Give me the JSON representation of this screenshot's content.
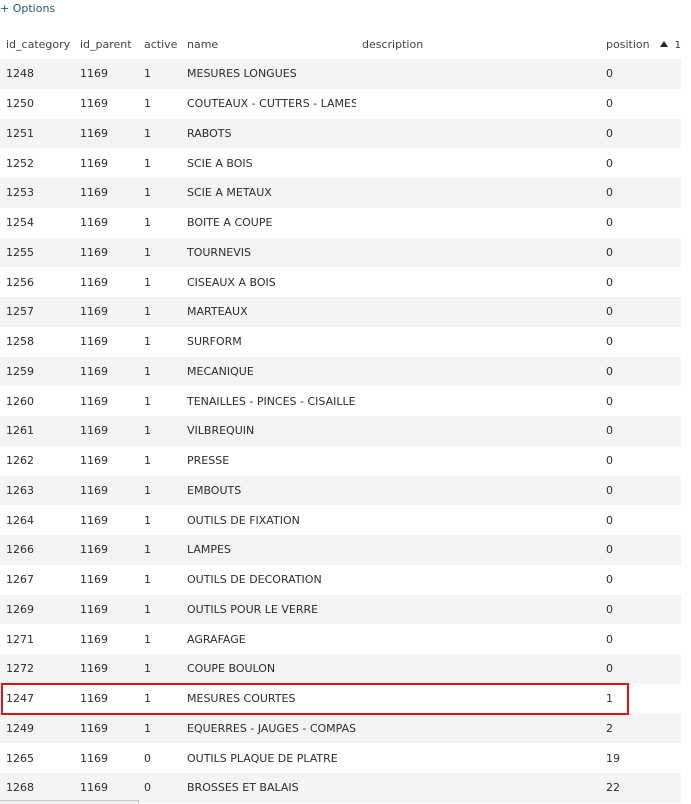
{
  "options_link": "+ Options",
  "columns": {
    "id_category": "id_category",
    "id_parent": "id_parent",
    "active": "active",
    "name": "name",
    "description": "description",
    "position": "position",
    "sort_order": "1"
  },
  "rows": [
    {
      "id_category": "1248",
      "id_parent": "1169",
      "active": "1",
      "name": "MESURES LONGUES",
      "description": "",
      "position": "0"
    },
    {
      "id_category": "1250",
      "id_parent": "1169",
      "active": "1",
      "name": "COUTEAUX - CUTTERS - LAMES",
      "description": "",
      "position": "0"
    },
    {
      "id_category": "1251",
      "id_parent": "1169",
      "active": "1",
      "name": "RABOTS",
      "description": "",
      "position": "0"
    },
    {
      "id_category": "1252",
      "id_parent": "1169",
      "active": "1",
      "name": "SCIE A BOIS",
      "description": "",
      "position": "0"
    },
    {
      "id_category": "1253",
      "id_parent": "1169",
      "active": "1",
      "name": "SCIE A METAUX",
      "description": "",
      "position": "0"
    },
    {
      "id_category": "1254",
      "id_parent": "1169",
      "active": "1",
      "name": "BOITE A COUPE",
      "description": "",
      "position": "0"
    },
    {
      "id_category": "1255",
      "id_parent": "1169",
      "active": "1",
      "name": "TOURNEVIS",
      "description": "",
      "position": "0"
    },
    {
      "id_category": "1256",
      "id_parent": "1169",
      "active": "1",
      "name": "CISEAUX A BOIS",
      "description": "",
      "position": "0"
    },
    {
      "id_category": "1257",
      "id_parent": "1169",
      "active": "1",
      "name": "MARTEAUX",
      "description": "",
      "position": "0"
    },
    {
      "id_category": "1258",
      "id_parent": "1169",
      "active": "1",
      "name": "SURFORM",
      "description": "",
      "position": "0"
    },
    {
      "id_category": "1259",
      "id_parent": "1169",
      "active": "1",
      "name": "MECANIQUE",
      "description": "",
      "position": "0"
    },
    {
      "id_category": "1260",
      "id_parent": "1169",
      "active": "1",
      "name": "TENAILLES - PINCES - CISAILLES",
      "description": "",
      "position": "0"
    },
    {
      "id_category": "1261",
      "id_parent": "1169",
      "active": "1",
      "name": "VILBREQUIN",
      "description": "",
      "position": "0"
    },
    {
      "id_category": "1262",
      "id_parent": "1169",
      "active": "1",
      "name": "PRESSE",
      "description": "",
      "position": "0"
    },
    {
      "id_category": "1263",
      "id_parent": "1169",
      "active": "1",
      "name": "EMBOUTS",
      "description": "",
      "position": "0"
    },
    {
      "id_category": "1264",
      "id_parent": "1169",
      "active": "1",
      "name": "OUTILS DE FIXATION",
      "description": "",
      "position": "0"
    },
    {
      "id_category": "1266",
      "id_parent": "1169",
      "active": "1",
      "name": "LAMPES",
      "description": "",
      "position": "0"
    },
    {
      "id_category": "1267",
      "id_parent": "1169",
      "active": "1",
      "name": "OUTILS DE DECORATION",
      "description": "",
      "position": "0"
    },
    {
      "id_category": "1269",
      "id_parent": "1169",
      "active": "1",
      "name": "OUTILS POUR LE VERRE",
      "description": "",
      "position": "0"
    },
    {
      "id_category": "1271",
      "id_parent": "1169",
      "active": "1",
      "name": "AGRAFAGE",
      "description": "",
      "position": "0"
    },
    {
      "id_category": "1272",
      "id_parent": "1169",
      "active": "1",
      "name": "COUPE BOULON",
      "description": "",
      "position": "0"
    },
    {
      "id_category": "1247",
      "id_parent": "1169",
      "active": "1",
      "name": "MESURES COURTES",
      "description": "",
      "position": "1"
    },
    {
      "id_category": "1249",
      "id_parent": "1169",
      "active": "1",
      "name": "EQUERRES - JAUGES - COMPAS",
      "description": "",
      "position": "2"
    },
    {
      "id_category": "1265",
      "id_parent": "1169",
      "active": "0",
      "name": "OUTILS PLAQUE DE PLATRE",
      "description": "",
      "position": "19"
    },
    {
      "id_category": "1268",
      "id_parent": "1169",
      "active": "0",
      "name": "BROSSES ET BALAIS",
      "description": "",
      "position": "22"
    }
  ],
  "highlight": {
    "row_id_category": "1247",
    "color": "#e0101a"
  },
  "colors": {
    "link": "#235a81",
    "row_alt": "#f4f4f4",
    "text": "#2c2c2c"
  }
}
